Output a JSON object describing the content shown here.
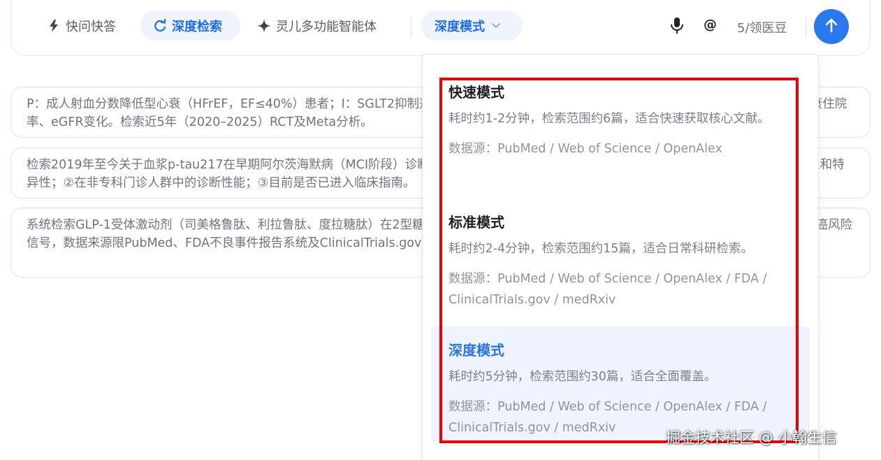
{
  "toolbar": {
    "quick_label": "快问快答",
    "deep_search_label": "深度检索",
    "agent_label": "灵儿多功能智能体",
    "mode_select_label": "深度模式",
    "at_label": "@",
    "beans_label": "5/领医豆"
  },
  "suggestions": [
    {
      "text": "P：成人射血分数降低型心衰（HFrEF，EF≤40%）患者；I：SGLT2抑制剂（达格列净、恩格列净）；C：安慰剂或标准治疗；O：全因死亡率、心衰住院率、eGFR变化。检索近5年（2020–2025）RCT及Meta分析。"
    },
    {
      "text": "检索2019年至今关于血浆p-tau217在早期阿尔茨海默病（MCI阶段）诊断中的研究，重点关注：①与脑脊液Aβ42/40及PET的头对头对比的敏感性和特异性；②在非专科门诊人群中的诊断性能；③目前是否已进入临床指南。"
    },
    {
      "text": "系统检索GLP-1受体激动剂（司美格鲁肽、利拉鲁肽、度拉糖肽）在2型糖尿病及肥胖患者中的胰腺安全性证据，结局包括急性胰腺炎发生率、胰腺癌风险信号，数据来源限PubMed、FDA不良事件报告系统及ClinicalTrials.gov注册研究，纳入队列研究、RCT和系统综述。"
    }
  ],
  "mode_menu": {
    "options": [
      {
        "title": "快速模式",
        "desc": "耗时约1-2分钟，检索范围约6篇，适合快速获取核心文献。",
        "source": "数据源：PubMed / Web of Science / OpenAlex"
      },
      {
        "title": "标准模式",
        "desc": "耗时约2-4分钟，检索范围约15篇，适合日常科研检索。",
        "source": "数据源：PubMed / Web of Science / OpenAlex / FDA / ClinicalTrials.gov / medRxiv"
      },
      {
        "title": "深度模式",
        "desc": "耗时约5分钟，检索范围约30篇，适合全面覆盖。",
        "source": "数据源：PubMed / Web of Science / OpenAlex / FDA / ClinicalTrials.gov / medRxiv"
      }
    ],
    "selected": "深度模式"
  },
  "watermark": "掘金技术社区 @ 小翰生信",
  "icons": {
    "quick": "lightning-icon",
    "deep_search": "refresh-search-icon",
    "agent": "sparkle-icon",
    "chevron": "chevron-down-icon",
    "mic": "microphone-icon",
    "send": "arrow-up-icon"
  },
  "colors": {
    "accent": "#2b78ee",
    "accent_text": "#1f6fe0",
    "selected_bg": "#eef3fd",
    "highlight": "#ee0000"
  }
}
